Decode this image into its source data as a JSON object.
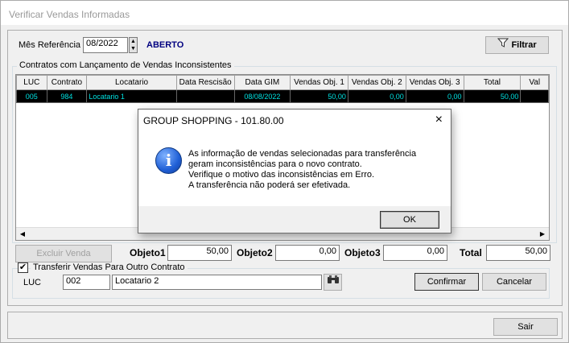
{
  "window": {
    "title": "Verificar Vendas Informadas"
  },
  "header": {
    "mes_label": "Mês Referência",
    "mes_value": "08/2022",
    "status": "ABERTO",
    "status_color": "#000080",
    "filter_label": "Filtrar"
  },
  "contracts_group": {
    "title": "Contratos com Lançamento de Vendas Inconsistentes",
    "columns": [
      "LUC",
      "Contrato",
      "Locatario",
      "Data Rescisão",
      "Data GIM",
      "Vendas Obj. 1",
      "Vendas Obj. 2",
      "Vendas Obj. 3",
      "Total",
      "Val"
    ],
    "rows": [
      [
        "005",
        "984",
        "Locatario 1",
        "",
        "08/08/2022",
        "50,00",
        "0,00",
        "0,00",
        "50,00",
        ""
      ]
    ]
  },
  "totals": {
    "exclude_label": "Excluir Venda",
    "obj1_label": "Objeto1",
    "obj1_value": "50,00",
    "obj2_label": "Objeto2",
    "obj2_value": "0,00",
    "obj3_label": "Objeto3",
    "obj3_value": "0,00",
    "total_label": "Total",
    "total_value": "50,00"
  },
  "transfer_group": {
    "title": "Transferir Vendas Para Outro Contrato",
    "checked": true,
    "luc_label": "LUC",
    "luc_value": "002",
    "locatario_value": "Locatario 2",
    "confirm_label": "Confirmar",
    "cancel_label": "Cancelar"
  },
  "footer": {
    "exit_label": "Sair"
  },
  "dialog": {
    "title": "GROUP SHOPPING - 101.80.00",
    "close_icon": "×",
    "icon": "info-icon",
    "lines": [
      "As informação de vendas selecionadas para transferência",
      "geram inconsistências para o novo contrato.",
      "Verifique o motivo das inconsistências em Erro.",
      "A transferência não poderá ser efetivada."
    ],
    "ok_label": "OK"
  }
}
